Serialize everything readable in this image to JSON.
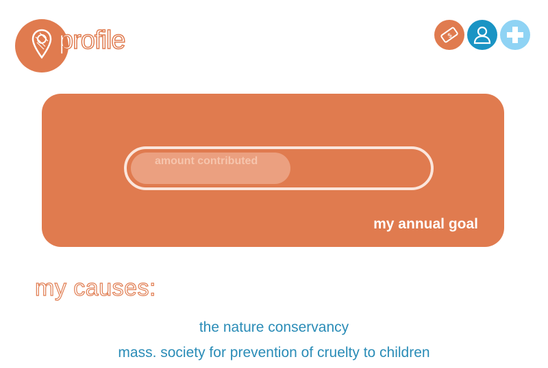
{
  "header": {
    "title": "profile",
    "logo_icon": "map-pin-icon",
    "actions": [
      {
        "name": "donate",
        "icon": "money-bill-icon",
        "color": "#e07b4f"
      },
      {
        "name": "account",
        "icon": "user-icon",
        "color": "#1a94c4"
      },
      {
        "name": "add",
        "icon": "plus-icon",
        "color": "#8fd3f4"
      }
    ]
  },
  "goal": {
    "progress_label": "amount contributed",
    "progress_fraction": 0.54,
    "goal_label": "my annual goal"
  },
  "causes": {
    "heading": "my causes:",
    "items": [
      "the nature conservancy",
      "mass. society for prevention of cruelty to children"
    ]
  },
  "colors": {
    "accent": "#e07b4f",
    "link": "#2a8cb7"
  }
}
